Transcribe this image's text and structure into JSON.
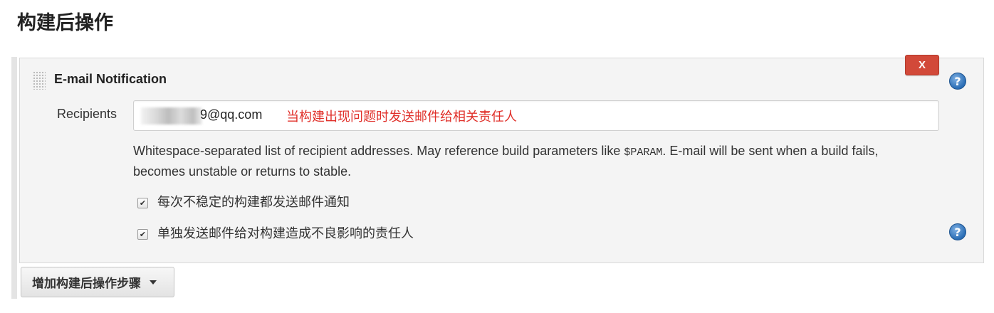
{
  "section": {
    "title": "构建后操作"
  },
  "panel": {
    "title": "E-mail Notification",
    "delete_label": "X",
    "help_glyph": "?",
    "help_icon": "question-mark-circle-icon",
    "recipients": {
      "label": "Recipients",
      "value": "9@qq.com",
      "annotation": "当构建出现问题时发送邮件给相关责任人"
    },
    "help_text": {
      "before": "Whitespace-separated list of recipient addresses. May reference build parameters like ",
      "code": "$PARAM",
      "after": ". E-mail will be sent when a build fails, becomes unstable or returns to stable."
    },
    "options": [
      {
        "label": "每次不稳定的构建都发送邮件通知",
        "checked": true
      },
      {
        "label": "单独发送邮件给对构建造成不良影响的责任人",
        "checked": true
      }
    ]
  },
  "add_step": {
    "label": "增加构建后操作步骤"
  },
  "colors": {
    "delete_button": "#d24939",
    "annotation": "#e0302a",
    "help_icon": "#2a6db5"
  }
}
